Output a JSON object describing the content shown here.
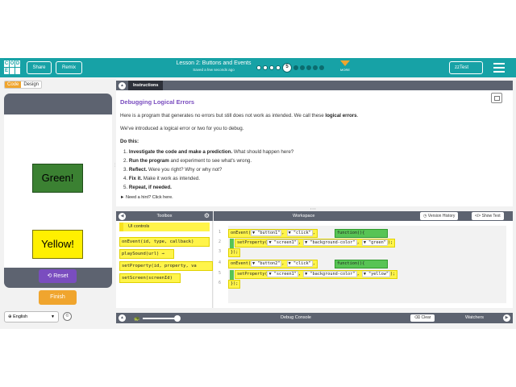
{
  "topbar": {
    "logo_letters": [
      "C",
      "O",
      "D",
      "E",
      "",
      ""
    ],
    "share_label": "Share",
    "remix_label": "Remix",
    "lesson_title": "Lesson 2: Buttons and Events",
    "saved_text": "Saved a few seconds ago",
    "current_level": "5",
    "more_label": "MORE",
    "user_label": "zzTest"
  },
  "mode": {
    "code_label": "Code",
    "design_label": "Design"
  },
  "app_screen": {
    "green_button_label": "Green!",
    "yellow_button_label": "Yellow!",
    "reset_label": "Reset",
    "finish_label": "Finish"
  },
  "footer": {
    "language": "English"
  },
  "instructions": {
    "tab_label": "Instructions",
    "title": "Debugging Logical Errors",
    "p1_pre": "Here is a program that generates no errors but still does not work as intended. We call these ",
    "p1_bold": "logical errors",
    "p1_post": ".",
    "p2": "We've introduced a logical error or two for you to debug.",
    "do_this": "Do this:",
    "steps": [
      {
        "num": "1.",
        "bold": "Investigate the code and make a prediction.",
        "rest": " What should happen here?"
      },
      {
        "num": "2.",
        "bold": "Run the program",
        "rest": " and experiment to see what's wrong."
      },
      {
        "num": "3.",
        "bold": "Reflect.",
        "rest": " Were you right? Why or why not?"
      },
      {
        "num": "4.",
        "bold": "Fix it.",
        "rest": " Make it work as intended."
      },
      {
        "num": "5.",
        "bold": "Repeat, if needed.",
        "rest": ""
      }
    ],
    "hint": "► Need a hint? Click here."
  },
  "toolbox": {
    "title": "Toolbox",
    "category": "UI controls",
    "blocks": [
      "onEvent(id, type, callback)",
      "playSound(url) →",
      "setProperty(id, property, va",
      "setScreen(screenId)"
    ]
  },
  "workspace": {
    "title": "Workspace",
    "version_history_label": "Version History",
    "show_text_label": "Show Text",
    "line_numbers": [
      "1",
      "2",
      "3",
      "4",
      "5",
      "6"
    ],
    "line1": {
      "fn": "onEvent(",
      "a1": "▼ \"button1\"",
      "sep": ", ",
      "a2": "▼ \"click\"",
      "end": ",",
      "cb": "function(){"
    },
    "line2": {
      "fn": "setProperty(",
      "a1": "▼ \"screen1\"",
      "a2": "▼ \"background-color\"",
      "a3": "▼ \"green\"",
      "end": ");"
    },
    "line3": {
      "close": "});"
    },
    "line4": {
      "fn": "onEvent(",
      "a1": "▼ \"button2\"",
      "sep": ", ",
      "a2": "▼ \"click\"",
      "end": ",",
      "cb": "function(){"
    },
    "line5": {
      "fn": "setProperty(",
      "a1": "▼ \"screen1\"",
      "a2": "▼ \"background-color\"",
      "a3": "▼ \"yellow\"",
      "end": ");"
    },
    "line6": {
      "close": "});"
    }
  },
  "debug": {
    "console_title": "Debug Console",
    "clear_label": "Clear",
    "watchers_label": "Watchers"
  },
  "colors": {
    "teal": "#17a2a6",
    "orange": "#f0a52e",
    "purple": "#7a4dbf",
    "header_gray": "#5d6370",
    "block_yellow": "#fff44a",
    "block_green": "#58c455"
  }
}
